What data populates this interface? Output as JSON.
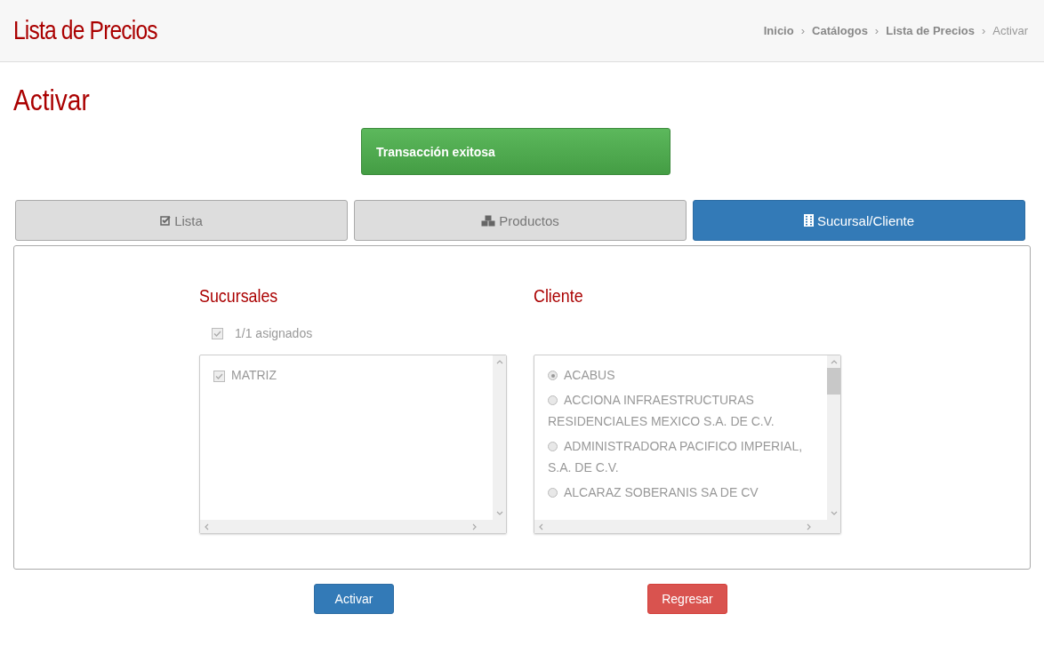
{
  "header": {
    "title": "Lista de Precios",
    "breadcrumb": [
      {
        "label": "Inicio",
        "current": false
      },
      {
        "label": "Catálogos",
        "current": false
      },
      {
        "label": "Lista de Precios",
        "current": false
      },
      {
        "label": "Activar",
        "current": true
      }
    ],
    "separator": "›"
  },
  "page_title": "Activar",
  "alert": "Transacción exitosa",
  "tabs": [
    {
      "label": "Lista",
      "selected": false
    },
    {
      "label": "Productos",
      "selected": false
    },
    {
      "label": "Sucursal/Cliente",
      "selected": true
    }
  ],
  "sucursales": {
    "title": "Sucursales",
    "all": {
      "label": "1/1 asignados",
      "checked": true
    },
    "items": [
      {
        "label": "MATRIZ",
        "checked": true
      }
    ]
  },
  "cliente": {
    "title": "Cliente",
    "items": [
      {
        "label": "ACABUS",
        "selected": true
      },
      {
        "label": "ACCIONA INFRAESTRUCTURAS RESIDENCIALES MEXICO S.A. DE C.V.",
        "selected": false
      },
      {
        "label": "ADMINISTRADORA PACIFICO IMPERIAL, S.A. DE C.V.",
        "selected": false
      },
      {
        "label": "ALCARAZ SOBERANIS SA DE CV",
        "selected": false
      }
    ]
  },
  "buttons": [
    {
      "label": "Activar",
      "kind": "primary"
    },
    {
      "label": "Regresar",
      "kind": "danger"
    }
  ]
}
